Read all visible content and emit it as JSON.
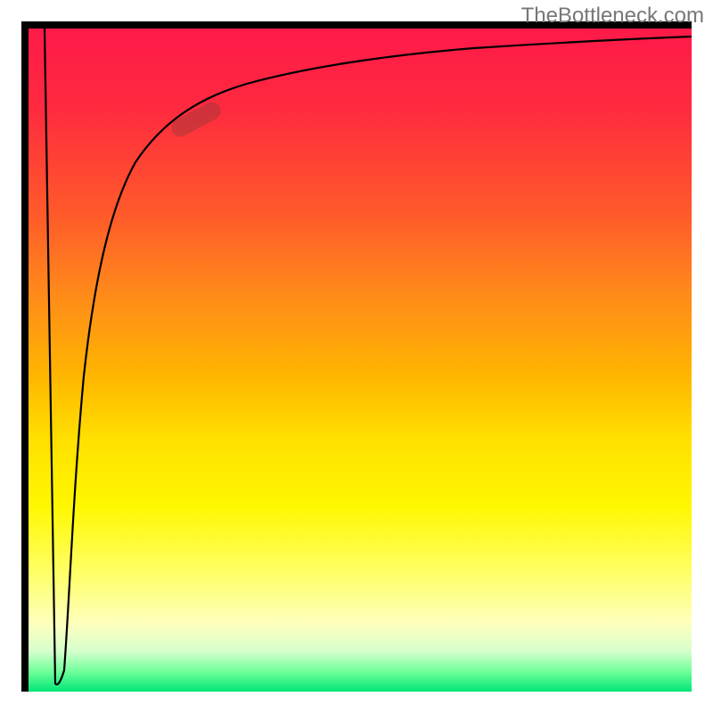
{
  "watermark": "TheBottleneck.com",
  "colors": {
    "gradient_top": "#ff1a49",
    "gradient_mid1": "#ff8a1a",
    "gradient_mid2": "#ffe000",
    "gradient_mid3": "#ffff66",
    "gradient_bottom": "#00e676",
    "curve": "#000000",
    "frame": "#000000",
    "marker": "rgba(120,60,55,0.35)"
  },
  "chart_data": {
    "type": "line",
    "title": "",
    "xlabel": "",
    "ylabel": "",
    "xlim": [
      0,
      100
    ],
    "ylim": [
      0,
      100
    ],
    "grid": false,
    "legend": false,
    "background": "vertical-gradient red→orange→yellow→green",
    "series": [
      {
        "name": "bottleneck-curve",
        "x": [
          2.4,
          4.0,
          5.4,
          6.7,
          8.3,
          10.0,
          12.5,
          16.1,
          20.2,
          25.5,
          32.9,
          41.7,
          53.8,
          67.2,
          80.0,
          90.0,
          100.0
        ],
        "values": [
          100,
          1.3,
          14.0,
          30.0,
          47.6,
          60.0,
          72.0,
          79.9,
          85.9,
          89.8,
          91.7,
          94.1,
          96.0,
          97.1,
          98.0,
          98.5,
          98.8
        ]
      }
    ],
    "annotations": [
      {
        "kind": "pill-marker",
        "x": 26.1,
        "y": 87.0,
        "rotation_deg": -28,
        "note": "highlighted point on curve"
      }
    ]
  }
}
